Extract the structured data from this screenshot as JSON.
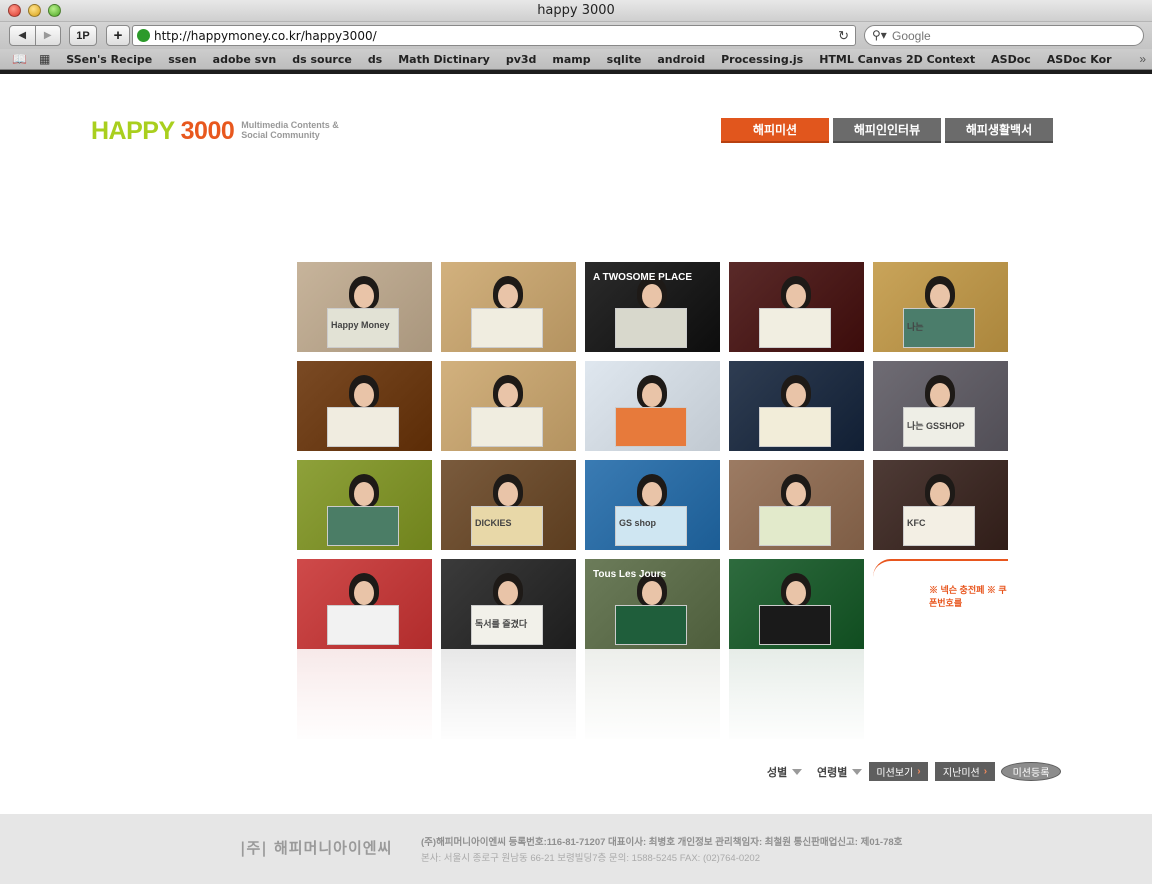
{
  "window": {
    "title": "happy 3000"
  },
  "toolbar": {
    "back_label": "◀",
    "forward_label": "▶",
    "one_page_label": "1P",
    "add_label": "+",
    "url": "http://happymoney.co.kr/happy3000/",
    "search_placeholder": "Google"
  },
  "bookmarks": [
    "SSen's Recipe",
    "ssen",
    "adobe svn",
    "ds source",
    "ds",
    "Math Dictinary",
    "pv3d",
    "mamp",
    "sqlite",
    "android",
    "Processing.js",
    "HTML Canvas 2D Context",
    "ASDoc",
    "ASDoc Kor"
  ],
  "header": {
    "logo_happy": "HAPPY",
    "logo_num": "3000",
    "tagline": "Multimedia Contents & Social Community",
    "nav": [
      "해피미션",
      "해피인인터뷰",
      "해피생활백서"
    ],
    "active_nav_index": 0
  },
  "gallery": {
    "tiles": [
      {
        "bg": "#c7b49b",
        "accent": "#e2e2d5",
        "sign": "Happy Money"
      },
      {
        "bg": "#d2b17e",
        "accent": "#f0ede0",
        "sign": ""
      },
      {
        "bg": "#2b2b2b",
        "accent": "#d8d8cc",
        "sign": "A TWOSOME PLACE"
      },
      {
        "bg": "#5a2a29",
        "accent": "#f1eee1",
        "sign": ""
      },
      {
        "bg": "#c9a45a",
        "accent": "#4b7d6b",
        "sign": "나는"
      },
      {
        "bg": "#7a4a24",
        "accent": "#f0ece0",
        "sign": ""
      },
      {
        "bg": "#d2b17e",
        "accent": "#f0ede0",
        "sign": ""
      },
      {
        "bg": "#dfe7ef",
        "accent": "#e77a3b",
        "sign": ""
      },
      {
        "bg": "#2f3d52",
        "accent": "#f2edd9",
        "sign": ""
      },
      {
        "bg": "#6f6c74",
        "accent": "#eeeee6",
        "sign": "나는 GSSHOP"
      },
      {
        "bg": "#8ea13a",
        "accent": "#4b7d66",
        "sign": ""
      },
      {
        "bg": "#7a5b3d",
        "accent": "#e8d8a8",
        "sign": "DICKIES"
      },
      {
        "bg": "#3a7bb3",
        "accent": "#cfe6f2",
        "sign": "GS shop"
      },
      {
        "bg": "#9c7b63",
        "accent": "#e2eacb",
        "sign": ""
      },
      {
        "bg": "#4e3b36",
        "accent": "#f3efe4",
        "sign": "KFC"
      },
      {
        "bg": "#cf4a4a",
        "accent": "#f2f2f2",
        "sign": ""
      },
      {
        "bg": "#3b3b3b",
        "accent": "#f2f1ea",
        "sign": "독서를 즐겼다"
      },
      {
        "bg": "#6c7c5a",
        "accent": "#1f5e3b",
        "sign": "Tous Les Jours"
      },
      {
        "bg": "#2e6b3e",
        "accent": "#1a1a1a",
        "sign": ""
      },
      {
        "bg": "#ffffff",
        "accent": "#e8561e",
        "sign": "※ 넥슨 충전페  ※ 쿠폰번호를"
      }
    ]
  },
  "controls": {
    "filter_gender": "성별",
    "filter_age": "연령별",
    "btn_view": "미션보기",
    "btn_past": "지난미션",
    "btn_register": "미션등록",
    "arrow": "›"
  },
  "footer": {
    "logo": "|주| 해피머니아이엔씨",
    "line1": "(주)해피머니아이엔씨   등록번호:116-81-71207   대표이사: 최병호   개인정보 관리책임자: 최철원   통신판매업신고: 제01-78호",
    "line2": "본사: 서울시 종로구 원남동 66-21 보령빌딩7층   문의: 1588-5245   FAX: (02)764-0202"
  },
  "colors": {
    "accent_orange": "#e1561d",
    "logo_green": "#a9cf1e",
    "nav_gray": "#6b6b6b"
  }
}
